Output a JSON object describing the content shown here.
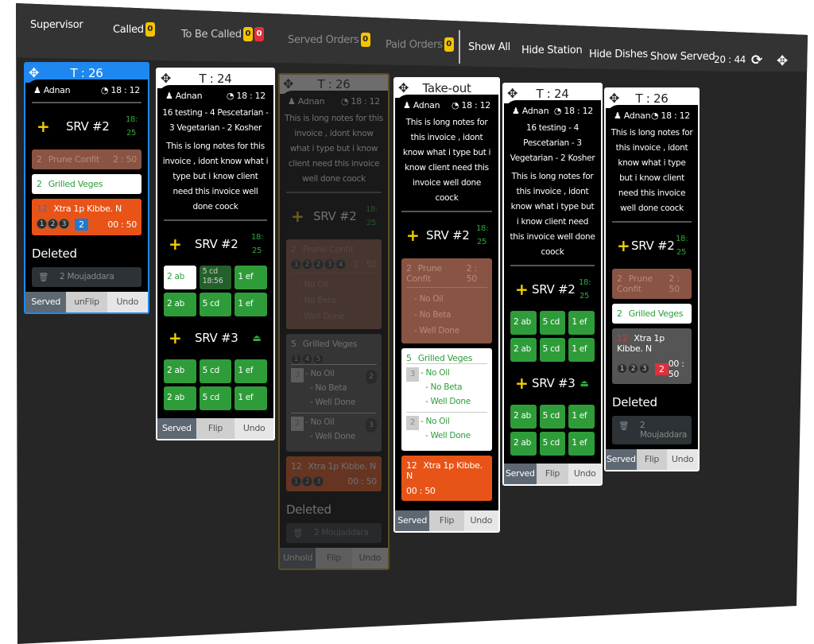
{
  "header": {
    "supervisor": "Supervisor",
    "called": {
      "label": "Called",
      "count": "0"
    },
    "to_be_called": {
      "label": "To Be Called",
      "count_yellow": "0",
      "count_red": "0"
    },
    "served_orders": {
      "label": "Served Orders",
      "count": "0"
    },
    "paid_orders": {
      "label": "Paid Orders",
      "count": "0"
    },
    "show_all": "Show All",
    "hide_station": "Hide Station",
    "hide_dishes": "Hide Dishes",
    "show_served": "Show Served",
    "clock": "20 : 44",
    "icons": {
      "refresh": "refresh-icon",
      "move": "move-arrows-icon"
    }
  },
  "colors": {
    "accent_blue": "#1e88f0",
    "green": "#2f9c3a",
    "orange": "#e85418",
    "brown": "#8a5444",
    "yellow": "#f5c400",
    "red": "#e0303c"
  },
  "cards": [
    {
      "title": "T : 26",
      "state": "selected",
      "waiter": "Adnan",
      "time": "18 : 12",
      "notes": [],
      "sections": [
        {
          "label": "SRV #2",
          "time": [
            "18:",
            "25"
          ],
          "items": [
            {
              "kind": "bar",
              "color": "brown",
              "qty": "2",
              "name": "Prune Confit",
              "timer": "2 : 50"
            },
            {
              "kind": "bar",
              "color": "white",
              "qty": "2",
              "name": "Grilled Veges"
            },
            {
              "kind": "bar",
              "color": "orange",
              "qty": "12",
              "name": "Xtra 1p Kibbe. N",
              "seats": [
                "1",
                "2",
                "3"
              ],
              "badge": "2",
              "badge_color": "blue",
              "timer": "00 : 50"
            }
          ]
        }
      ],
      "deleted": {
        "title": "Deleted",
        "items": [
          {
            "qty": "2",
            "name": "Moujaddara"
          }
        ]
      },
      "footer": [
        "Served",
        "unFlip",
        "Undo"
      ]
    },
    {
      "title": "T : 24",
      "state": "normal",
      "waiter": "Adnan",
      "time": "18 : 12",
      "notes": [
        "16 testing - 4 Pescetarian - 3 Vegetarian - 2 Kosher",
        "This is long notes for this invoice , idont know what i type but i know client need this invoice well done coock"
      ],
      "sections": [
        {
          "label": "SRV #2",
          "time": [
            "18:",
            "25"
          ],
          "items": [
            {
              "kind": "grid",
              "cells": [
                {
                  "qty": "2",
                  "name": "ab",
                  "style": "white"
                },
                {
                  "qty": "5",
                  "name": "cd",
                  "sub": "18:56",
                  "style": "dark"
                },
                {
                  "qty": "1",
                  "name": "ef"
                },
                {
                  "qty": "2",
                  "name": "ab"
                },
                {
                  "qty": "5",
                  "name": "cd"
                },
                {
                  "qty": "1",
                  "name": "ef"
                }
              ]
            }
          ]
        },
        {
          "label": "SRV #3",
          "eject": true,
          "items": [
            {
              "kind": "grid",
              "cells": [
                {
                  "qty": "2",
                  "name": "ab"
                },
                {
                  "qty": "5",
                  "name": "cd"
                },
                {
                  "qty": "1",
                  "name": "ef"
                },
                {
                  "qty": "2",
                  "name": "ab"
                },
                {
                  "qty": "5",
                  "name": "cd"
                },
                {
                  "qty": "1",
                  "name": "ef"
                }
              ]
            }
          ]
        }
      ],
      "footer": [
        "Served",
        "Flip",
        "Undo"
      ]
    },
    {
      "title": "T : 26",
      "state": "faded",
      "waiter": "Adnan",
      "time": "18 : 12",
      "notes": [
        "This is long notes for this invoice , idont know what i type but i know client need this invoice well done coock"
      ],
      "sections": [
        {
          "label": "SRV #2",
          "time": [
            "18:",
            "25"
          ],
          "items": [
            {
              "kind": "bar",
              "color": "brown",
              "qty": "2",
              "name": "Prune Confit",
              "timer": "2 : 50",
              "seats": [
                "1",
                "2",
                "2",
                "3",
                "4"
              ],
              "mods": [
                "- No Oil",
                "- No Beta",
                "- Well Done"
              ]
            },
            {
              "kind": "bar",
              "color": "gray",
              "qty": "5",
              "name": "Grilled Veges",
              "seats": [
                "1",
                "4",
                "5"
              ],
              "subs": [
                {
                  "qty": "3",
                  "seat": "2",
                  "mods": [
                    "- No Oil",
                    "- No Beta",
                    "- Well Done"
                  ]
                },
                {
                  "qty": "2",
                  "seat": "3",
                  "mods": [
                    "- No Oil",
                    "- Well Done"
                  ]
                }
              ]
            },
            {
              "kind": "bar",
              "color": "orange",
              "qty": "12",
              "name": "Xtra 1p Kibbe. N",
              "seats": [
                "1",
                "2",
                "3"
              ],
              "timer": "00 : 50"
            }
          ]
        }
      ],
      "deleted": {
        "title": "Deleted",
        "items": [
          {
            "qty": "2",
            "name": "Moujaddara"
          }
        ]
      },
      "footer": [
        "Unhold",
        "Flip",
        "Undo"
      ]
    },
    {
      "title": "Take-out",
      "state": "normal",
      "waiter": "Adnan",
      "time": "18 : 12",
      "notes": [
        "This is long notes for this invoice , idont know what i type but i know client need this invoice well done coock"
      ],
      "sections": [
        {
          "label": "SRV #2",
          "time": [
            "18:",
            "25"
          ],
          "items": [
            {
              "kind": "bar",
              "color": "brown",
              "qty": "2",
              "name": "Prune Confit",
              "timer": "2 : 50",
              "mods": [
                "- No Oil",
                "- No Beta",
                "- Well Done"
              ]
            },
            {
              "kind": "bar",
              "color": "white",
              "qty": "5",
              "name": "Grilled Veges",
              "subs": [
                {
                  "qty": "3",
                  "mods": [
                    "- No Oil",
                    "- No Beta",
                    "- Well Done"
                  ]
                },
                {
                  "qty": "2",
                  "mods": [
                    "- No Oil",
                    "- Well Done"
                  ]
                }
              ]
            },
            {
              "kind": "bar",
              "color": "orange",
              "qty": "12",
              "name": "Xtra 1p Kibbe. N",
              "timer2": "00 : 50"
            }
          ]
        }
      ],
      "footer": [
        "Served",
        "Flip",
        "Undo"
      ]
    },
    {
      "title": "T : 24",
      "state": "normal",
      "waiter": "Adnan",
      "time": "18 : 12",
      "notes": [
        "16 testing - 4 Pescetarian - 3 Vegetarian - 2 Kosher",
        "This is long notes for this invoice , idont know what i type but i know client need this invoice well done coock"
      ],
      "sections": [
        {
          "label": "SRV #2",
          "time": [
            "18:",
            "25"
          ],
          "items": [
            {
              "kind": "grid",
              "cells": [
                {
                  "qty": "2",
                  "name": "ab"
                },
                {
                  "qty": "5",
                  "name": "cd"
                },
                {
                  "qty": "1",
                  "name": "ef"
                },
                {
                  "qty": "2",
                  "name": "ab"
                },
                {
                  "qty": "5",
                  "name": "cd"
                },
                {
                  "qty": "1",
                  "name": "ef"
                }
              ]
            }
          ]
        },
        {
          "label": "SRV #3",
          "eject": true,
          "items": [
            {
              "kind": "grid",
              "cells": [
                {
                  "qty": "2",
                  "name": "ab"
                },
                {
                  "qty": "5",
                  "name": "cd"
                },
                {
                  "qty": "1",
                  "name": "ef"
                },
                {
                  "qty": "2",
                  "name": "ab"
                },
                {
                  "qty": "5",
                  "name": "cd"
                },
                {
                  "qty": "1",
                  "name": "ef"
                }
              ]
            }
          ]
        }
      ],
      "footer": [
        "Served",
        "Flip",
        "Undo"
      ]
    },
    {
      "title": "T : 26",
      "state": "normal",
      "waiter": "Adnan",
      "time": "18 : 12",
      "notes": [
        "This is long notes for this invoice , idont know what i type but i know client need this invoice well done coock"
      ],
      "sections": [
        {
          "label": "SRV #2",
          "time": [
            "18:",
            "25"
          ],
          "items": [
            {
              "kind": "bar",
              "color": "brown",
              "qty": "2",
              "name": "Prune Confit",
              "timer": "2 : 50"
            },
            {
              "kind": "bar",
              "color": "white",
              "qty": "2",
              "name": "Grilled Veges"
            },
            {
              "kind": "bar",
              "color": "gray",
              "qty": "12",
              "name": "Xtra 1p Kibbe. N",
              "seats": [
                "1",
                "2",
                "3"
              ],
              "badge": "2",
              "badge_color": "red",
              "timer": "00 : 50"
            }
          ]
        }
      ],
      "deleted": {
        "title": "Deleted",
        "items": [
          {
            "qty": "2",
            "name": "Moujaddara"
          }
        ]
      },
      "footer": [
        "Served",
        "Flip",
        "Undo"
      ]
    }
  ]
}
